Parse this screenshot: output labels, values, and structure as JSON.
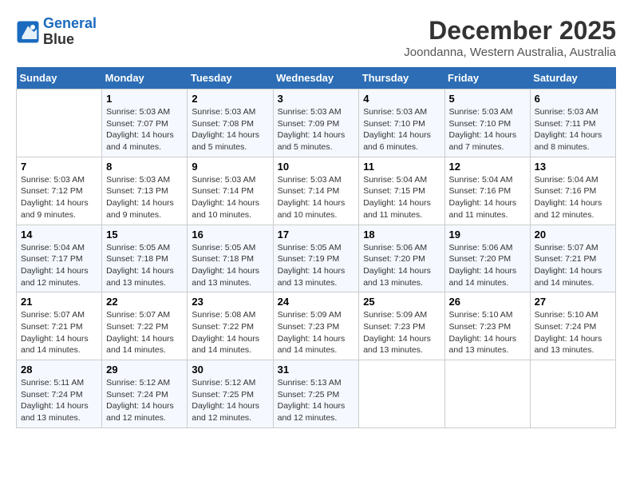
{
  "header": {
    "logo_line1": "General",
    "logo_line2": "Blue",
    "month": "December 2025",
    "location": "Joondanna, Western Australia, Australia"
  },
  "weekdays": [
    "Sunday",
    "Monday",
    "Tuesday",
    "Wednesday",
    "Thursday",
    "Friday",
    "Saturday"
  ],
  "weeks": [
    [
      {
        "day": "",
        "info": ""
      },
      {
        "day": "1",
        "info": "Sunrise: 5:03 AM\nSunset: 7:07 PM\nDaylight: 14 hours\nand 4 minutes."
      },
      {
        "day": "2",
        "info": "Sunrise: 5:03 AM\nSunset: 7:08 PM\nDaylight: 14 hours\nand 5 minutes."
      },
      {
        "day": "3",
        "info": "Sunrise: 5:03 AM\nSunset: 7:09 PM\nDaylight: 14 hours\nand 5 minutes."
      },
      {
        "day": "4",
        "info": "Sunrise: 5:03 AM\nSunset: 7:10 PM\nDaylight: 14 hours\nand 6 minutes."
      },
      {
        "day": "5",
        "info": "Sunrise: 5:03 AM\nSunset: 7:10 PM\nDaylight: 14 hours\nand 7 minutes."
      },
      {
        "day": "6",
        "info": "Sunrise: 5:03 AM\nSunset: 7:11 PM\nDaylight: 14 hours\nand 8 minutes."
      }
    ],
    [
      {
        "day": "7",
        "info": "Sunrise: 5:03 AM\nSunset: 7:12 PM\nDaylight: 14 hours\nand 9 minutes."
      },
      {
        "day": "8",
        "info": "Sunrise: 5:03 AM\nSunset: 7:13 PM\nDaylight: 14 hours\nand 9 minutes."
      },
      {
        "day": "9",
        "info": "Sunrise: 5:03 AM\nSunset: 7:14 PM\nDaylight: 14 hours\nand 10 minutes."
      },
      {
        "day": "10",
        "info": "Sunrise: 5:03 AM\nSunset: 7:14 PM\nDaylight: 14 hours\nand 10 minutes."
      },
      {
        "day": "11",
        "info": "Sunrise: 5:04 AM\nSunset: 7:15 PM\nDaylight: 14 hours\nand 11 minutes."
      },
      {
        "day": "12",
        "info": "Sunrise: 5:04 AM\nSunset: 7:16 PM\nDaylight: 14 hours\nand 11 minutes."
      },
      {
        "day": "13",
        "info": "Sunrise: 5:04 AM\nSunset: 7:16 PM\nDaylight: 14 hours\nand 12 minutes."
      }
    ],
    [
      {
        "day": "14",
        "info": "Sunrise: 5:04 AM\nSunset: 7:17 PM\nDaylight: 14 hours\nand 12 minutes."
      },
      {
        "day": "15",
        "info": "Sunrise: 5:05 AM\nSunset: 7:18 PM\nDaylight: 14 hours\nand 13 minutes."
      },
      {
        "day": "16",
        "info": "Sunrise: 5:05 AM\nSunset: 7:18 PM\nDaylight: 14 hours\nand 13 minutes."
      },
      {
        "day": "17",
        "info": "Sunrise: 5:05 AM\nSunset: 7:19 PM\nDaylight: 14 hours\nand 13 minutes."
      },
      {
        "day": "18",
        "info": "Sunrise: 5:06 AM\nSunset: 7:20 PM\nDaylight: 14 hours\nand 13 minutes."
      },
      {
        "day": "19",
        "info": "Sunrise: 5:06 AM\nSunset: 7:20 PM\nDaylight: 14 hours\nand 14 minutes."
      },
      {
        "day": "20",
        "info": "Sunrise: 5:07 AM\nSunset: 7:21 PM\nDaylight: 14 hours\nand 14 minutes."
      }
    ],
    [
      {
        "day": "21",
        "info": "Sunrise: 5:07 AM\nSunset: 7:21 PM\nDaylight: 14 hours\nand 14 minutes."
      },
      {
        "day": "22",
        "info": "Sunrise: 5:07 AM\nSunset: 7:22 PM\nDaylight: 14 hours\nand 14 minutes."
      },
      {
        "day": "23",
        "info": "Sunrise: 5:08 AM\nSunset: 7:22 PM\nDaylight: 14 hours\nand 14 minutes."
      },
      {
        "day": "24",
        "info": "Sunrise: 5:09 AM\nSunset: 7:23 PM\nDaylight: 14 hours\nand 14 minutes."
      },
      {
        "day": "25",
        "info": "Sunrise: 5:09 AM\nSunset: 7:23 PM\nDaylight: 14 hours\nand 13 minutes."
      },
      {
        "day": "26",
        "info": "Sunrise: 5:10 AM\nSunset: 7:23 PM\nDaylight: 14 hours\nand 13 minutes."
      },
      {
        "day": "27",
        "info": "Sunrise: 5:10 AM\nSunset: 7:24 PM\nDaylight: 14 hours\nand 13 minutes."
      }
    ],
    [
      {
        "day": "28",
        "info": "Sunrise: 5:11 AM\nSunset: 7:24 PM\nDaylight: 14 hours\nand 13 minutes."
      },
      {
        "day": "29",
        "info": "Sunrise: 5:12 AM\nSunset: 7:24 PM\nDaylight: 14 hours\nand 12 minutes."
      },
      {
        "day": "30",
        "info": "Sunrise: 5:12 AM\nSunset: 7:25 PM\nDaylight: 14 hours\nand 12 minutes."
      },
      {
        "day": "31",
        "info": "Sunrise: 5:13 AM\nSunset: 7:25 PM\nDaylight: 14 hours\nand 12 minutes."
      },
      {
        "day": "",
        "info": ""
      },
      {
        "day": "",
        "info": ""
      },
      {
        "day": "",
        "info": ""
      }
    ]
  ]
}
